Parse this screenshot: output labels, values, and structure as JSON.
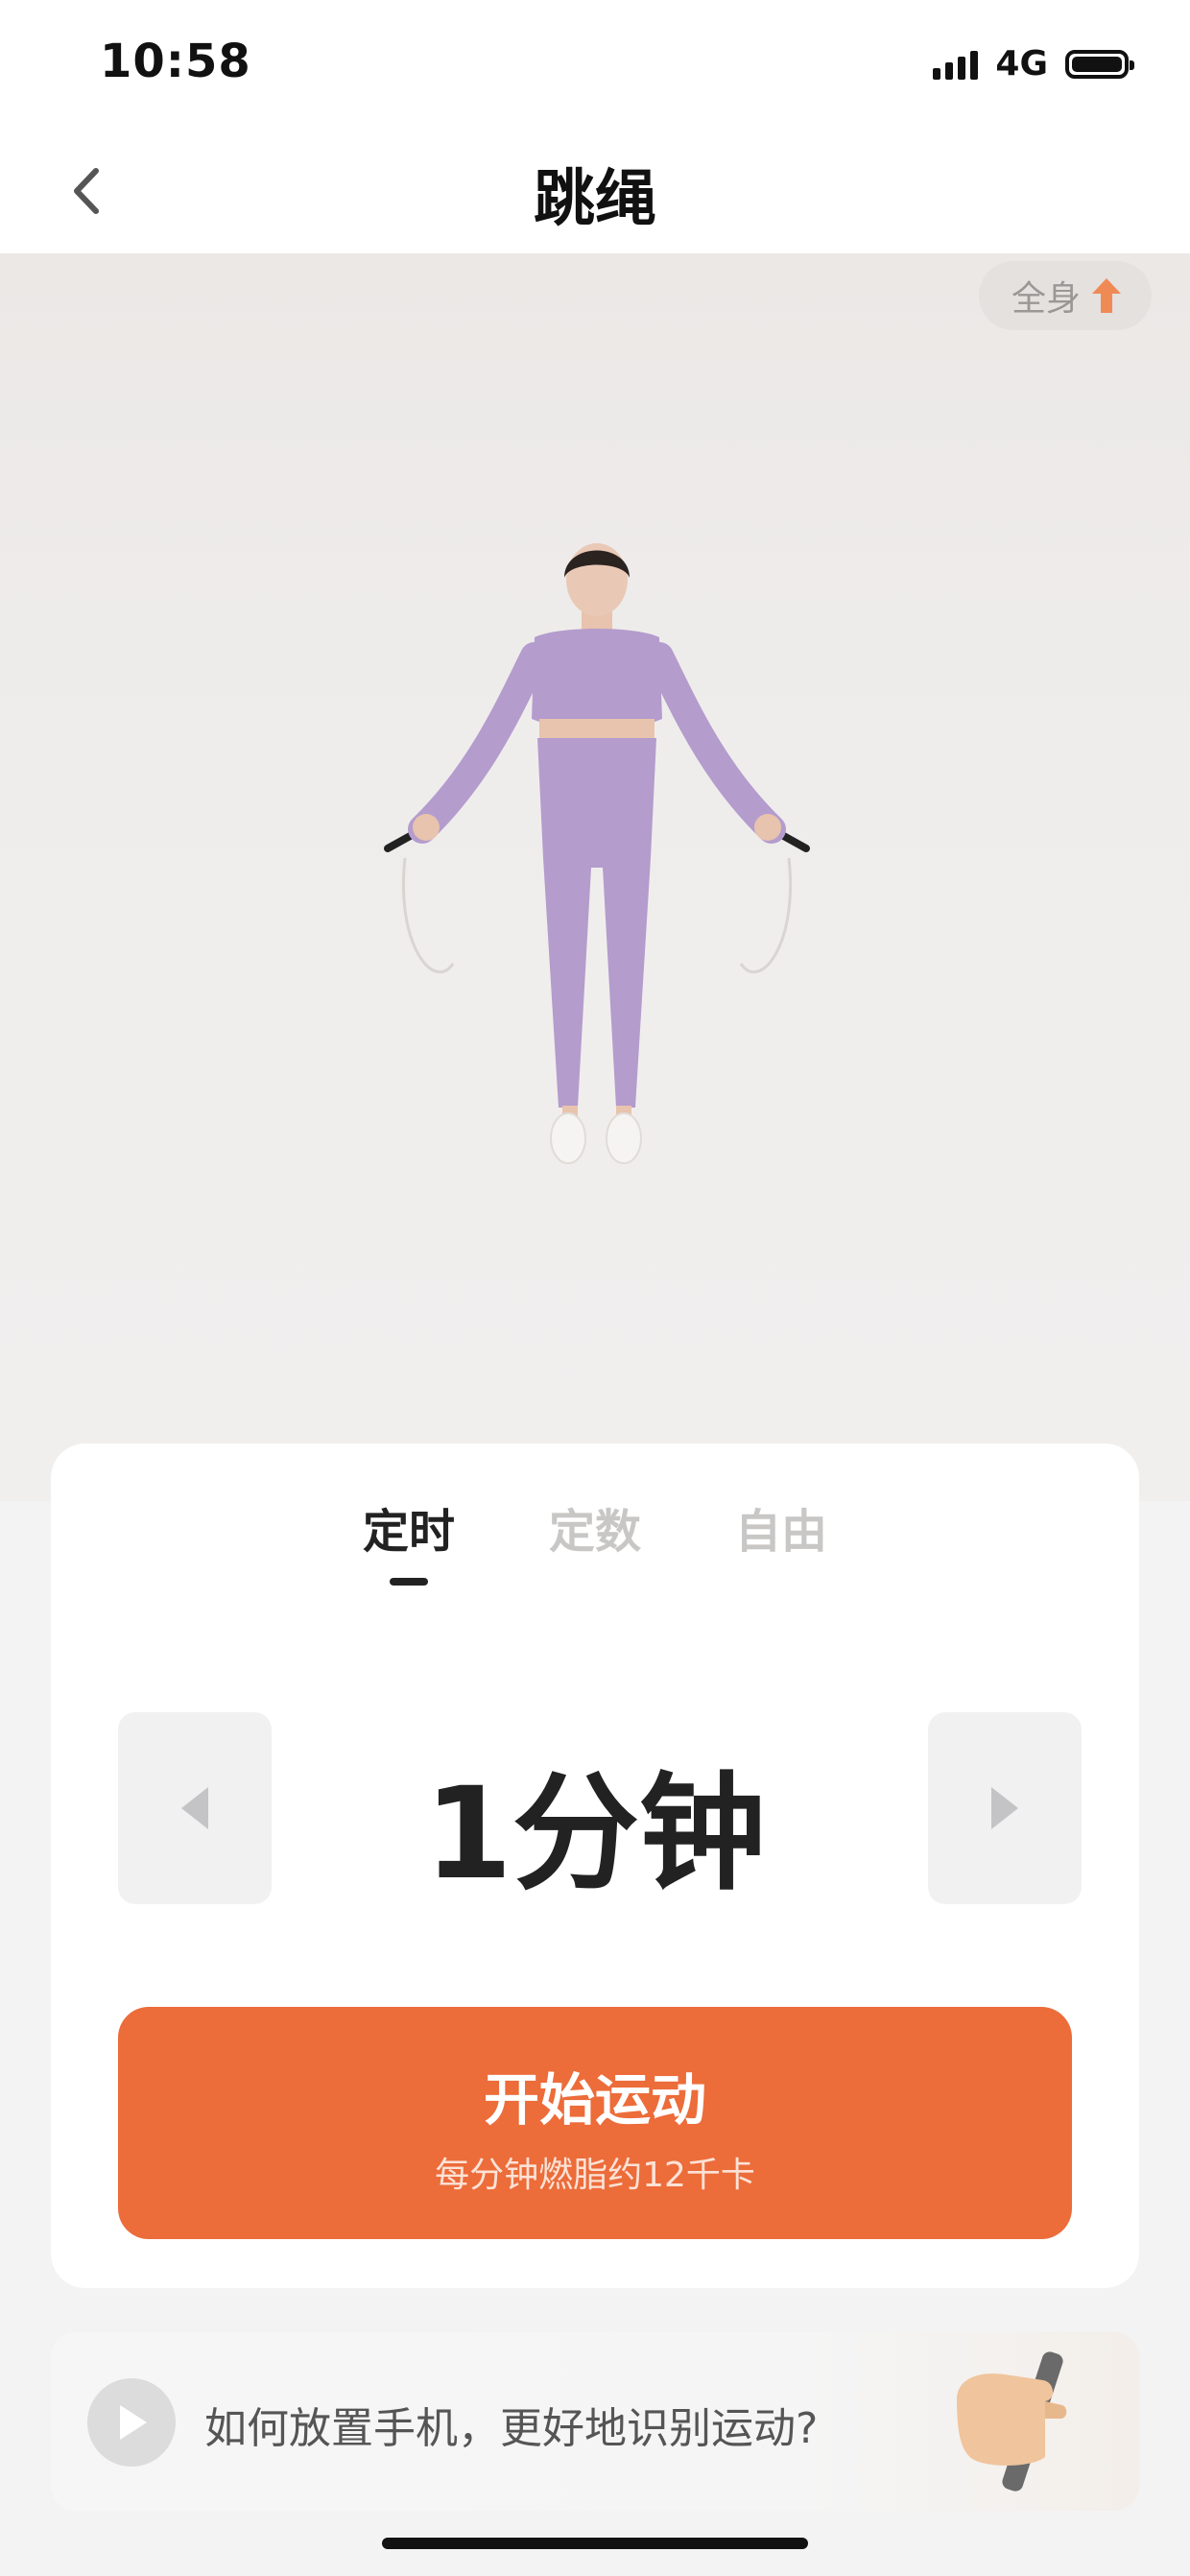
{
  "status_bar": {
    "time": "10:58",
    "network": "4G"
  },
  "nav": {
    "title": "跳绳"
  },
  "hero": {
    "badge_label": "全身"
  },
  "mode_tabs": [
    {
      "label": "定时",
      "active": true
    },
    {
      "label": "定数",
      "active": false
    },
    {
      "label": "自由",
      "active": false
    }
  ],
  "stepper": {
    "value": "1分钟"
  },
  "start_button": {
    "title": "开始运动",
    "subtitle": "每分钟燃脂约12千卡"
  },
  "tip": {
    "text": "如何放置手机，更好地识别运动?"
  },
  "colors": {
    "accent": "#ec6c3a",
    "badge_arrow": "#f08a55",
    "outfit": "#b49ccd"
  },
  "icons": [
    "back-chevron-icon",
    "arrow-up-icon",
    "triangle-left-icon",
    "triangle-right-icon",
    "play-icon",
    "hand-phone-icon"
  ]
}
